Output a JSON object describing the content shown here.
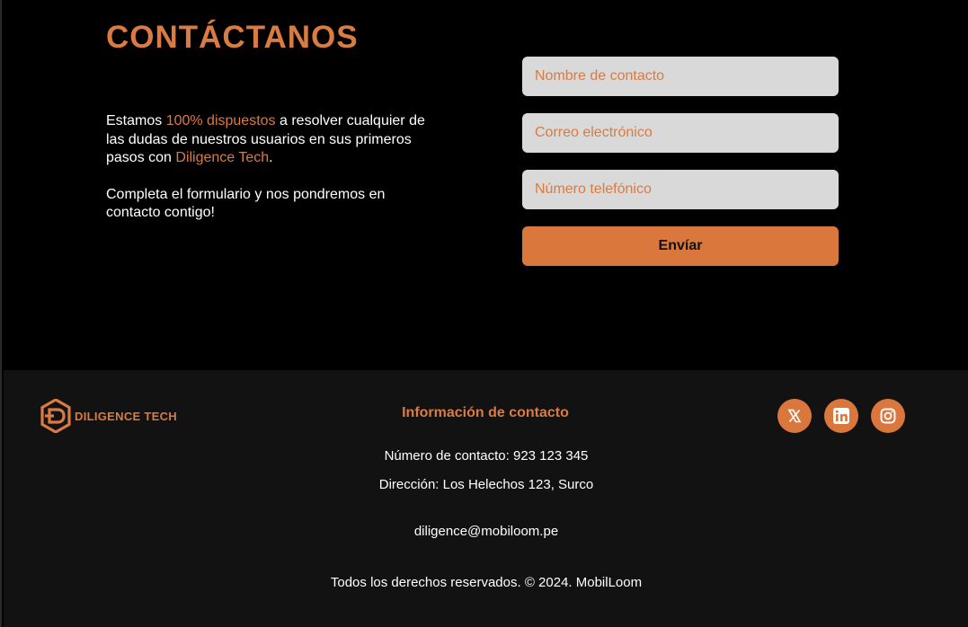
{
  "contact": {
    "title": "CONTÁCTANOS",
    "intro": {
      "part1": "Estamos ",
      "highlight": "100% dispuestos",
      "part2": " a resolver cualquier de las dudas de nuestros usuarios en sus primeros pasos con ",
      "brand": "Diligence Tech",
      "part3": ".",
      "paragraph2": "Completa  el formulario y nos pondremos en contacto contigo!"
    },
    "form": {
      "name_placeholder": "Nombre de contacto",
      "email_placeholder": "Correo electrónico",
      "phone_placeholder": "Número telefónico",
      "submit_label": "Envíar"
    }
  },
  "footer": {
    "brand": {
      "name": "DILIGENCE TECH",
      "logo_icon": "hexagon-d-logo-icon"
    },
    "heading": "Información de contacto",
    "phone": "Número de contacto: 923 123 345",
    "address_label": "Dirección: Los Helechos 123, ",
    "address_district": "Surco",
    "email": "diligence@mobiloom.pe",
    "copyright_text": "Todos los derechos reservados. © 2024. ",
    "copyright_brand": "MobilLoom",
    "social": [
      {
        "name": "X",
        "icon": "x-icon"
      },
      {
        "name": "LinkedIn",
        "icon": "linkedin-icon"
      },
      {
        "name": "Instagram",
        "icon": "instagram-icon"
      }
    ]
  },
  "colors": {
    "accent": "#d97b42",
    "page_background": "#000000",
    "footer_background": "#121212",
    "input_background": "#d9d9d9"
  }
}
